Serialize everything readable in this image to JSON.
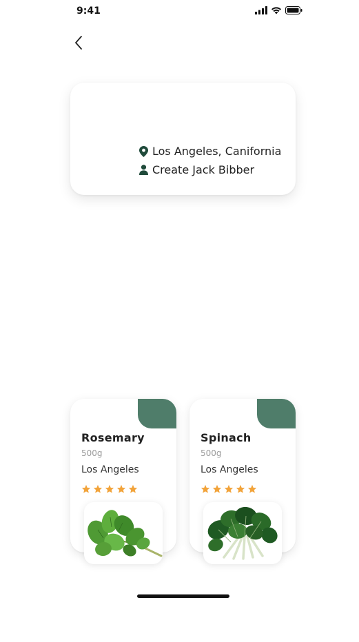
{
  "status_bar": {
    "time": "9:41"
  },
  "location_card": {
    "location": "Los Angeles, Canifornia",
    "creator": "Create Jack Bibber"
  },
  "products": [
    {
      "name": "Rosemary",
      "weight": "500g",
      "location": "Los Angeles",
      "rating": 5
    },
    {
      "name": "Spinach",
      "weight": "500g",
      "location": "Los Angeles",
      "rating": 5
    }
  ],
  "colors": {
    "accent": "#4f7d6a",
    "star": "#f2a33a",
    "icon_dark": "#1f4a3a"
  },
  "icons": [
    "back-chevron-icon",
    "location-pin-icon",
    "person-icon",
    "star-icon",
    "signal-icon",
    "wifi-icon",
    "battery-icon"
  ]
}
